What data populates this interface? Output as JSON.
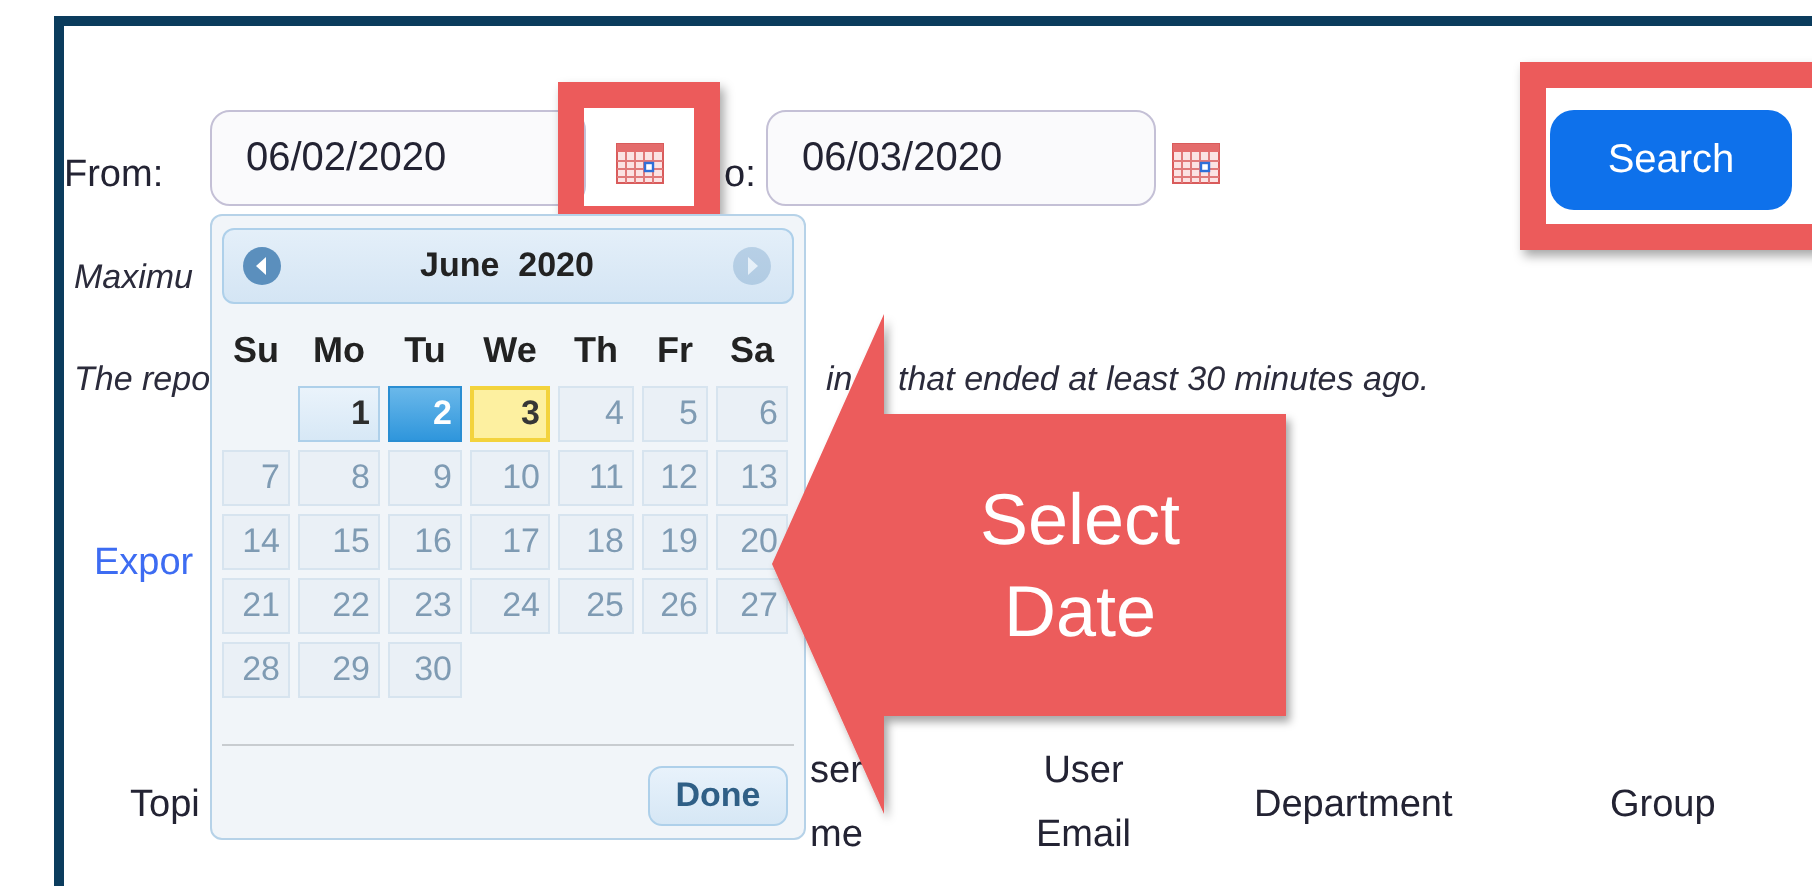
{
  "filter": {
    "from_label": "From:",
    "from_value": "06/02/2020",
    "to_label": "o:",
    "to_value": "06/03/2020",
    "search_button": "Search"
  },
  "notes": {
    "max_note": "Maximu",
    "report_note_start": "The repo",
    "report_note_mid": "in",
    "report_note_end": "that ended at least 30 minutes ago."
  },
  "export_link": "Expor",
  "table_headers": [
    {
      "lines": [
        "Topi"
      ]
    },
    {
      "lines": [
        "ser",
        "me"
      ]
    },
    {
      "lines": [
        "User",
        "Email"
      ]
    },
    {
      "lines": [
        "Department"
      ]
    },
    {
      "lines": [
        "Group"
      ]
    }
  ],
  "datepicker": {
    "month": "June",
    "year": "2020",
    "prev_disabled": false,
    "next_disabled": true,
    "weekdays": [
      "Su",
      "Mo",
      "Tu",
      "We",
      "Th",
      "Fr",
      "Sa"
    ],
    "weeks": [
      [
        {
          "kind": "blank"
        },
        {
          "label": "1",
          "selected": false,
          "highlighted": false,
          "disabled": false
        },
        {
          "label": "2",
          "selected": true,
          "highlighted": false,
          "disabled": false
        },
        {
          "label": "3",
          "selected": false,
          "highlighted": true,
          "disabled": false
        },
        {
          "label": "4",
          "selected": false,
          "highlighted": false,
          "disabled": true
        },
        {
          "label": "5",
          "selected": false,
          "highlighted": false,
          "disabled": true
        },
        {
          "label": "6",
          "selected": false,
          "highlighted": false,
          "disabled": true
        }
      ],
      [
        {
          "label": "7",
          "selected": false,
          "highlighted": false,
          "disabled": true
        },
        {
          "label": "8",
          "selected": false,
          "highlighted": false,
          "disabled": true
        },
        {
          "label": "9",
          "selected": false,
          "highlighted": false,
          "disabled": true
        },
        {
          "label": "10",
          "selected": false,
          "highlighted": false,
          "disabled": true
        },
        {
          "label": "11",
          "selected": false,
          "highlighted": false,
          "disabled": true
        },
        {
          "label": "12",
          "selected": false,
          "highlighted": false,
          "disabled": true
        },
        {
          "label": "13",
          "selected": false,
          "highlighted": false,
          "disabled": true
        }
      ],
      [
        {
          "label": "14",
          "selected": false,
          "highlighted": false,
          "disabled": true
        },
        {
          "label": "15",
          "selected": false,
          "highlighted": false,
          "disabled": true
        },
        {
          "label": "16",
          "selected": false,
          "highlighted": false,
          "disabled": true
        },
        {
          "label": "17",
          "selected": false,
          "highlighted": false,
          "disabled": true
        },
        {
          "label": "18",
          "selected": false,
          "highlighted": false,
          "disabled": true
        },
        {
          "label": "19",
          "selected": false,
          "highlighted": false,
          "disabled": true
        },
        {
          "label": "20",
          "selected": false,
          "highlighted": false,
          "disabled": true
        }
      ],
      [
        {
          "label": "21",
          "selected": false,
          "highlighted": false,
          "disabled": true
        },
        {
          "label": "22",
          "selected": false,
          "highlighted": false,
          "disabled": true
        },
        {
          "label": "23",
          "selected": false,
          "highlighted": false,
          "disabled": true
        },
        {
          "label": "24",
          "selected": false,
          "highlighted": false,
          "disabled": true
        },
        {
          "label": "25",
          "selected": false,
          "highlighted": false,
          "disabled": true
        },
        {
          "label": "26",
          "selected": false,
          "highlighted": false,
          "disabled": true
        },
        {
          "label": "27",
          "selected": false,
          "highlighted": false,
          "disabled": true
        }
      ],
      [
        {
          "label": "28",
          "selected": false,
          "highlighted": false,
          "disabled": true
        },
        {
          "label": "29",
          "selected": false,
          "highlighted": false,
          "disabled": true
        },
        {
          "label": "30",
          "selected": false,
          "highlighted": false,
          "disabled": true
        }
      ]
    ],
    "done_button": "Done"
  },
  "callout": {
    "lines": [
      "Select",
      "Date"
    ]
  }
}
